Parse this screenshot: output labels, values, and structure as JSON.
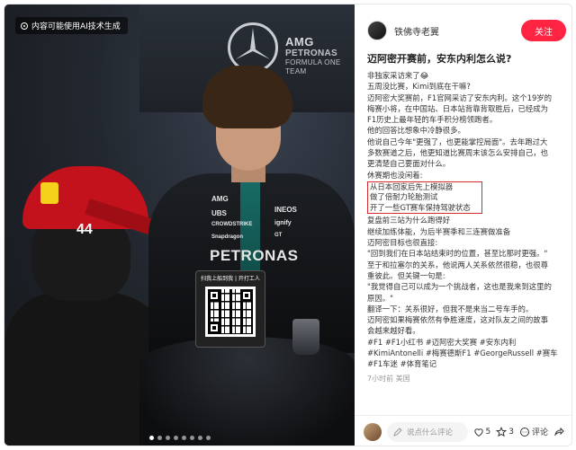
{
  "image": {
    "ai_badge": "内容可能使用AI技术生成",
    "brand": {
      "amg": "AMG",
      "petronas": "PETRONAS",
      "team": "FORMULA ONE TEAM"
    },
    "cap_number": "44",
    "suit": {
      "amg": "AMG",
      "ubs": "UBS",
      "crowdstrike": "CROWDSTRIKE",
      "ineos": "INEOS",
      "ignify": "ignify",
      "snapdragon": "Snapdragon",
      "gt": "GT",
      "petronas": "PETRONAS"
    },
    "qr_stand_title": "扫我上船到我 | 开打工人",
    "carousel_count": 8,
    "carousel_active": 1
  },
  "author": {
    "name": "铁佛寺老翼",
    "follow_label": "关注"
  },
  "post": {
    "title": "迈阿密开赛前，安东内利怎么说?",
    "lines_before": [
      "非独家采访来了😂",
      "五周没比赛，Kimi到底在干嘛?",
      "迈阿密大奖赛前，F1官网采访了安东内利。这个19岁的",
      "梅赛小将，在中国站、日本站背靠背取胜后，已经成为",
      "F1历史上最年轻的车手积分榜领跑者。",
      "他的回答比想象中冷静很多。",
      "他说自己今年\"更强了，也更能掌控局面\"。去年跑过大",
      "多数赛道之后，他更知道比赛周末该怎么安排自己，也",
      "更清楚自己要面对什么。",
      "休赛期也没闲着:"
    ],
    "highlighted": [
      "从日本回家后先上模拟器",
      "做了倍耐力轮胎测试",
      "开了一些GT赛车保持驾驶状态"
    ],
    "lines_after": [
      "复盘前三站为什么跑得好",
      "继续加练体能，为后半赛季和三连赛做准备",
      "迈阿密目标也很直接:",
      "\"回到我们在日本站结束时的位置，甚至比那时更强。\"",
      "至于和拉塞尔的关系，他说两人关系依然很稳，也很尊",
      "重彼此。但关键一句是:",
      "\"我觉得自己可以成为一个挑战者，这也是我来到这里的",
      "原因。\"",
      "翻译一下：关系很好，但我不是来当二号车手的。",
      "迈阿密如果梅赛依然有争胜速度，这对队友之间的故事",
      "会越来越好看。"
    ],
    "tags": [
      "#F1 #F1小红书 #迈阿密大奖赛 #安东内利",
      "#KimiAntonelli #梅赛德斯F1 #GeorgeRussell #赛车",
      "#F1车迷 #体育笔记"
    ],
    "meta": "7小时前 美国"
  },
  "footer": {
    "comment_placeholder": "说点什么评论",
    "likes": "5",
    "stars": "3",
    "comment_label": "评论"
  }
}
